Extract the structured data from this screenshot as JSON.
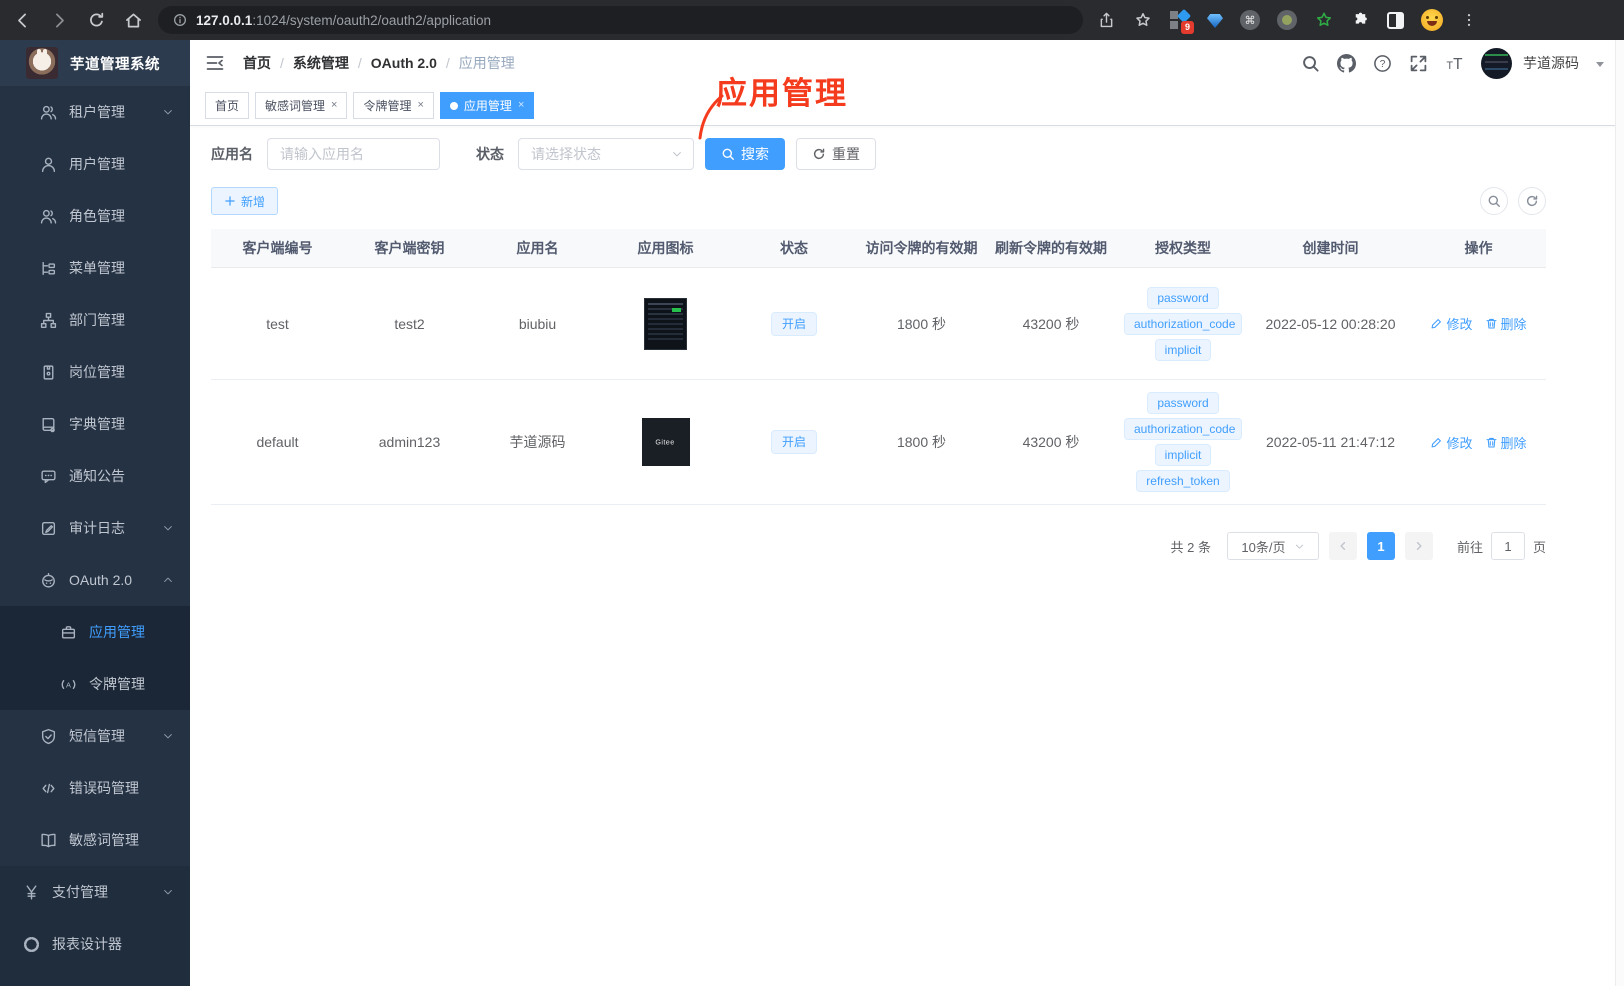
{
  "colors": {
    "accent": "#409eff",
    "annotation_red": "#f53b1d",
    "tag_bg": "#ecf5ff",
    "tag_border": "#d9ecff",
    "sidebar_bg": "#253243"
  },
  "browser": {
    "url_host": "127.0.0.1",
    "url_path": ":1024/system/oauth2/oauth2/application",
    "extension_badge": "9"
  },
  "sidebar": {
    "title": "芋道管理系统",
    "items": [
      {
        "label": "租户管理",
        "icon": "users",
        "chevron": "down",
        "level": "top"
      },
      {
        "label": "用户管理",
        "icon": "user",
        "level": "top"
      },
      {
        "label": "角色管理",
        "icon": "users",
        "level": "top"
      },
      {
        "label": "菜单管理",
        "icon": "tree",
        "level": "top"
      },
      {
        "label": "部门管理",
        "icon": "org",
        "level": "top"
      },
      {
        "label": "岗位管理",
        "icon": "badge",
        "level": "top"
      },
      {
        "label": "字典管理",
        "icon": "dict",
        "level": "top"
      },
      {
        "label": "通知公告",
        "icon": "bubble",
        "level": "top"
      },
      {
        "label": "审计日志",
        "icon": "log",
        "chevron": "down",
        "level": "top"
      },
      {
        "label": "OAuth 2.0",
        "icon": "robot",
        "chevron": "up",
        "level": "top"
      },
      {
        "label": "应用管理",
        "icon": "briefcase",
        "level": "sub",
        "active": true
      },
      {
        "label": "令牌管理",
        "icon": "token",
        "level": "sub"
      },
      {
        "label": "短信管理",
        "icon": "shield",
        "chevron": "down",
        "level": "top"
      },
      {
        "label": "错误码管理",
        "icon": "code",
        "level": "top"
      },
      {
        "label": "敏感词管理",
        "icon": "bookopen",
        "level": "top"
      },
      {
        "label": "支付管理",
        "icon": "yen",
        "chevron": "down",
        "level": "bottom"
      },
      {
        "label": "报表设计器",
        "icon": "report",
        "level": "bottom"
      }
    ]
  },
  "navbar": {
    "breadcrumb": [
      "首页",
      "系统管理",
      "OAuth 2.0",
      "应用管理"
    ],
    "separator": "/",
    "username": "芋道源码"
  },
  "tabs": [
    {
      "label": "首页",
      "closable": false,
      "active": false
    },
    {
      "label": "敏感词管理",
      "closable": true,
      "active": false
    },
    {
      "label": "令牌管理",
      "closable": true,
      "active": false
    },
    {
      "label": "应用管理",
      "closable": true,
      "active": true
    }
  ],
  "annotation": "应用管理",
  "filter": {
    "name_label": "应用名",
    "name_placeholder": "请输入应用名",
    "status_label": "状态",
    "status_placeholder": "请选择状态",
    "search_label": "搜索",
    "reset_label": "重置",
    "add_label": "新增"
  },
  "table": {
    "headers": [
      "客户端编号",
      "客户端密钥",
      "应用名",
      "应用图标",
      "状态",
      "访问令牌的有效期",
      "刷新令牌的有效期",
      "授权类型",
      "创建时间",
      "操作"
    ],
    "edit_label": "修改",
    "delete_label": "删除",
    "rows": [
      {
        "client_id": "test",
        "client_secret": "test2",
        "app_name": "biubiu",
        "app_icon": "screenshot",
        "app_icon_label": "",
        "status": "开启",
        "access_token_validity": "1800 秒",
        "refresh_token_validity": "43200 秒",
        "grant_types": [
          "password",
          "authorization_code",
          "implicit"
        ],
        "created_at": "2022-05-12 00:28:20"
      },
      {
        "client_id": "default",
        "client_secret": "admin123",
        "app_name": "芋道源码",
        "app_icon": "gitee",
        "app_icon_label": "Gitee",
        "status": "开启",
        "access_token_validity": "1800 秒",
        "refresh_token_validity": "43200 秒",
        "grant_types": [
          "password",
          "authorization_code",
          "implicit",
          "refresh_token"
        ],
        "created_at": "2022-05-11 21:47:12"
      }
    ]
  },
  "pagination": {
    "total": "共 2 条",
    "page_size": "10条/页",
    "current_page": "1",
    "goto_label": "前往",
    "goto_value": "1",
    "unit_label": "页"
  }
}
